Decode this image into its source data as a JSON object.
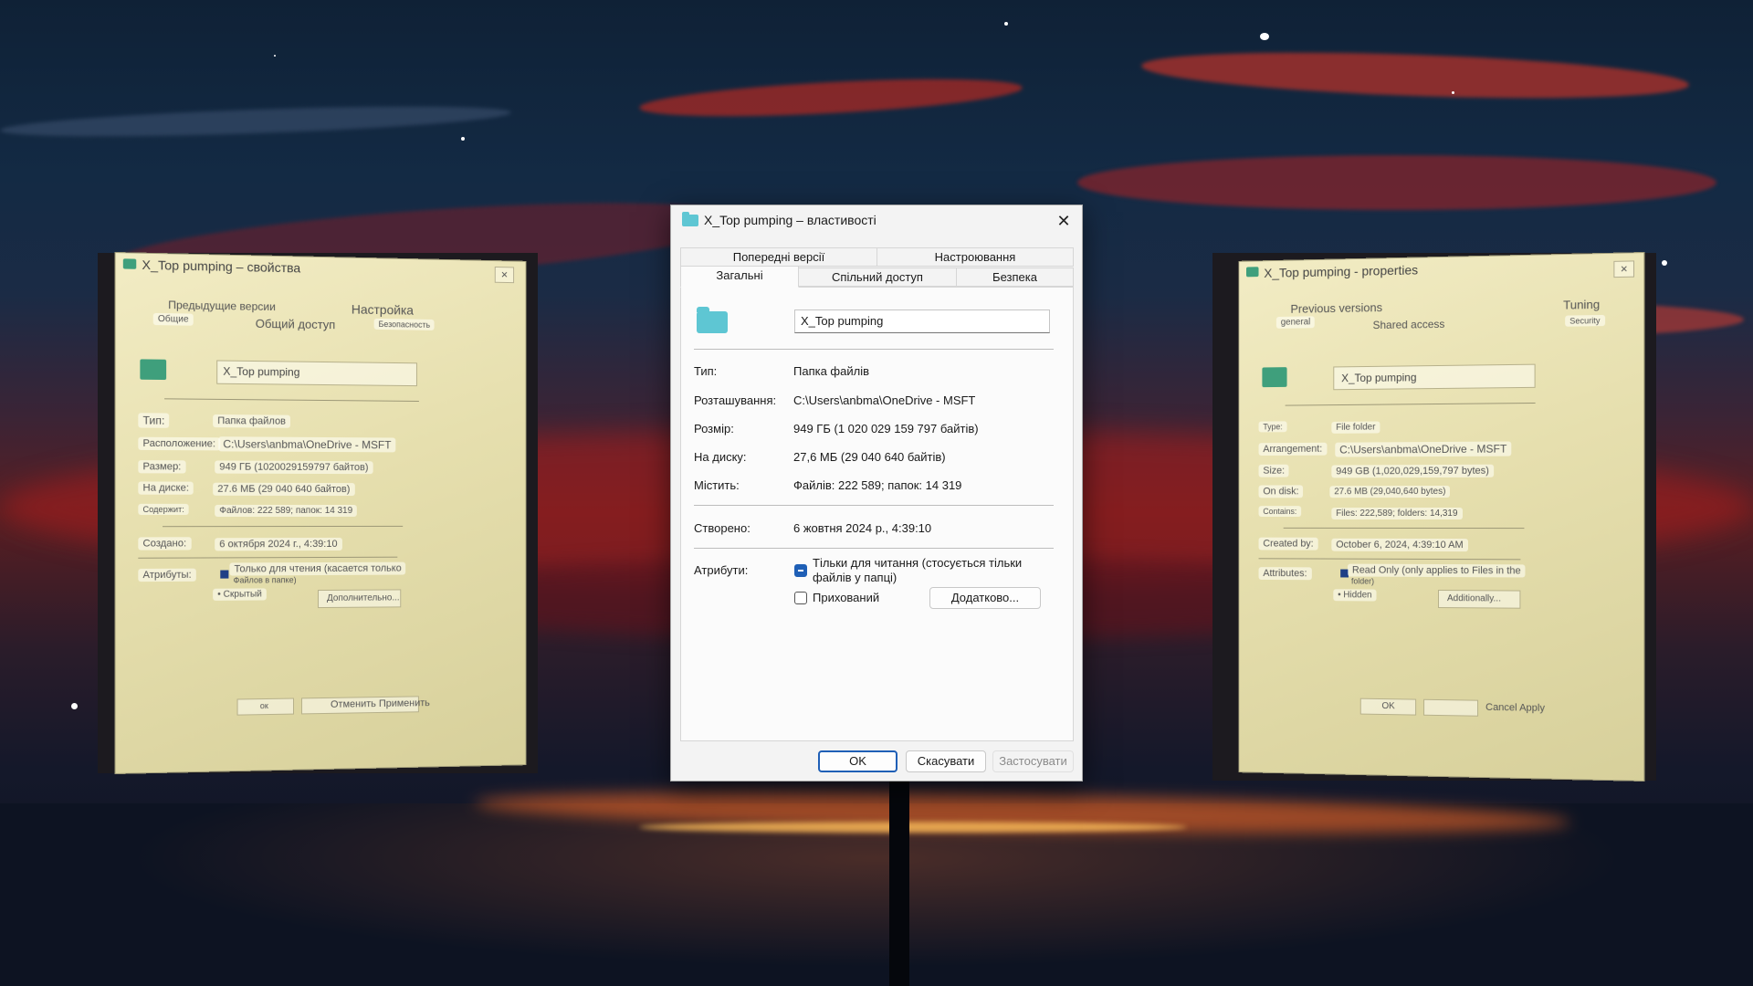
{
  "main": {
    "title": "X_Top pumping – властивості",
    "tabs_top": [
      "Попередні версії",
      "Настроювання"
    ],
    "tabs_bottom": [
      "Загальні",
      "Спільний доступ",
      "Безпека"
    ],
    "name": "X_Top pumping",
    "rows": [
      {
        "label": "Тип:",
        "value": "Папка файлів"
      },
      {
        "label": "Розташування:",
        "value": "C:\\Users\\anbma\\OneDrive - MSFT"
      },
      {
        "label": "Розмір:",
        "value": "949 ГБ (1 020 029 159 797 байтів)"
      },
      {
        "label": "На диску:",
        "value": "27,6 МБ (29 040 640 байтів)"
      },
      {
        "label": "Містить:",
        "value": "Файлів: 222 589; папок: 14 319"
      }
    ],
    "created_label": "Створено:",
    "created_value": "6 жовтня 2024 р., 4:39:10",
    "attributes_label": "Атрибути:",
    "readonly_text_line1": "Тільки для читання (стосується тільки",
    "readonly_text_line2": "файлів у папці)",
    "hidden_text": "Прихований",
    "advanced_btn": "Додатково...",
    "ok_btn": "OK",
    "cancel_btn": "Скасувати",
    "apply_btn": "Застосувати"
  },
  "left": {
    "title": "X_Top pumping – свойства",
    "tab1": "Предыдущие версии",
    "tab2": "Настройка",
    "tab3": "Общие",
    "tab4": "Общий доступ",
    "tab5": "Безопасность",
    "name": "X_Top pumping",
    "type_label": "Тип:",
    "type_value": "Папка файлов",
    "location_label": "Расположение:",
    "location_value": "C:\\Users\\anbma\\OneDrive - MSFT",
    "size_label": "Размер:",
    "size_value": "949 ГБ (1020029159797 байтов)",
    "disk_label": "На диске:",
    "disk_value": "27.6 МБ (29 040 640 байтов)",
    "contains_label": "Содержит:",
    "contains_value": "Файлов: 222 589; папок: 14 319",
    "created_label": "Создано:",
    "created_value": "6 октября 2024 г., 4:39:10",
    "attr_label": "Атрибуты:",
    "readonly_line1": "Только для чтения (касается только",
    "readonly_line2": "Файлов в папке)",
    "hidden": "• Скрытый",
    "advanced": "Дополнительно...",
    "ok": "ок",
    "cancel_apply": "Отменить Применить"
  },
  "right": {
    "title": "X_Top pumping - properties",
    "tab1": "Previous versions",
    "tab2": "Tuning",
    "tab3": "general",
    "tab4": "Shared access",
    "tab5": "Security",
    "name": "X_Top pumping",
    "type_label": "Type:",
    "type_value": "File folder",
    "arr_label": "Arrangement:",
    "arr_value": "C:\\Users\\anbma\\OneDrive - MSFT",
    "size_label": "Size:",
    "size_value": "949 GB (1,020,029,159,797 bytes)",
    "disk_label": "On disk:",
    "disk_value": "27.6 MB (29,040,640 bytes)",
    "contains_label": "Contains:",
    "contains_value": "Files: 222,589; folders: 14,319",
    "created_label": "Created by:",
    "created_value": "October 6, 2024, 4:39:10 AM",
    "attr_label": "Attributes:",
    "readonly_line1": "Read Only (only applies to Files in the",
    "readonly_line2": "folder)",
    "hidden": "• Hidden",
    "advanced": "Additionally...",
    "ok": "OK",
    "cancel_apply": "Cancel Apply"
  }
}
